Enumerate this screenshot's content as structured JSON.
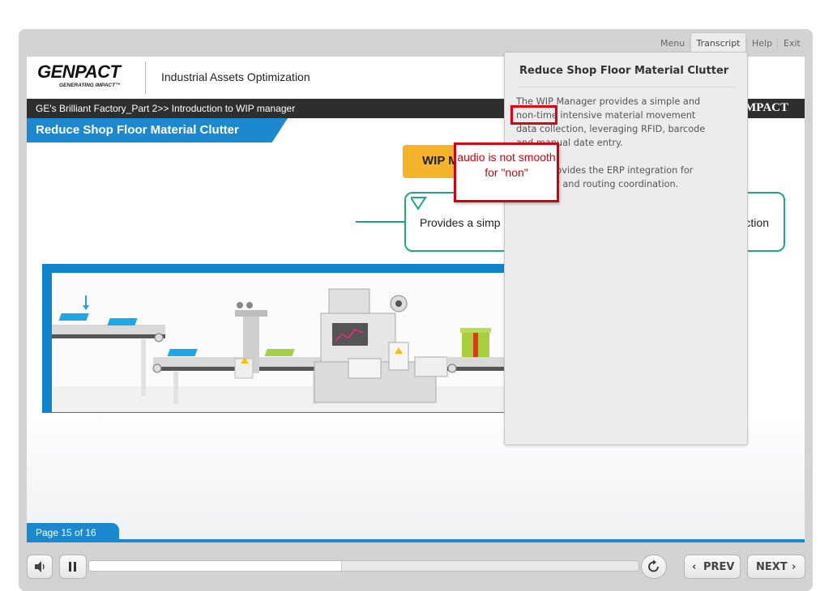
{
  "nav": {
    "menu": "Menu",
    "transcript": "Transcript",
    "help": "Help",
    "exit": "Exit"
  },
  "header": {
    "logo": "GENPACT",
    "tagline": "GENERATING IMPACT™",
    "course_title": "Industrial Assets Optimization",
    "breadcrumb": "GE's Brilliant Factory_Part 2>> Introduction to WIP manager",
    "brand_right": "MPACT"
  },
  "slide": {
    "title": "Reduce Shop Floor Material Clutter",
    "wip_label": "WIP M",
    "callout_text": "Provides a simp",
    "callout_text_right": "ction"
  },
  "transcript": {
    "title": "Reduce Shop Floor Material Clutter",
    "para1": "The WIP Manager provides a simple and non-time intensive material movement data collection, leveraging RFID, barcode and manual date entry.",
    "para2": "It also provides the ERP integration for inventory and routing coordination."
  },
  "annotation": {
    "text": "audio is not smooth for \"non\""
  },
  "footer": {
    "page_label": "Page 15 of 16"
  },
  "player": {
    "prev": "PREV",
    "next": "NEXT",
    "progress": 0.46
  },
  "colors": {
    "accent": "#1b88cf",
    "wip": "#f4b52c",
    "callout": "#22a58b",
    "annotation": "#d20010"
  }
}
